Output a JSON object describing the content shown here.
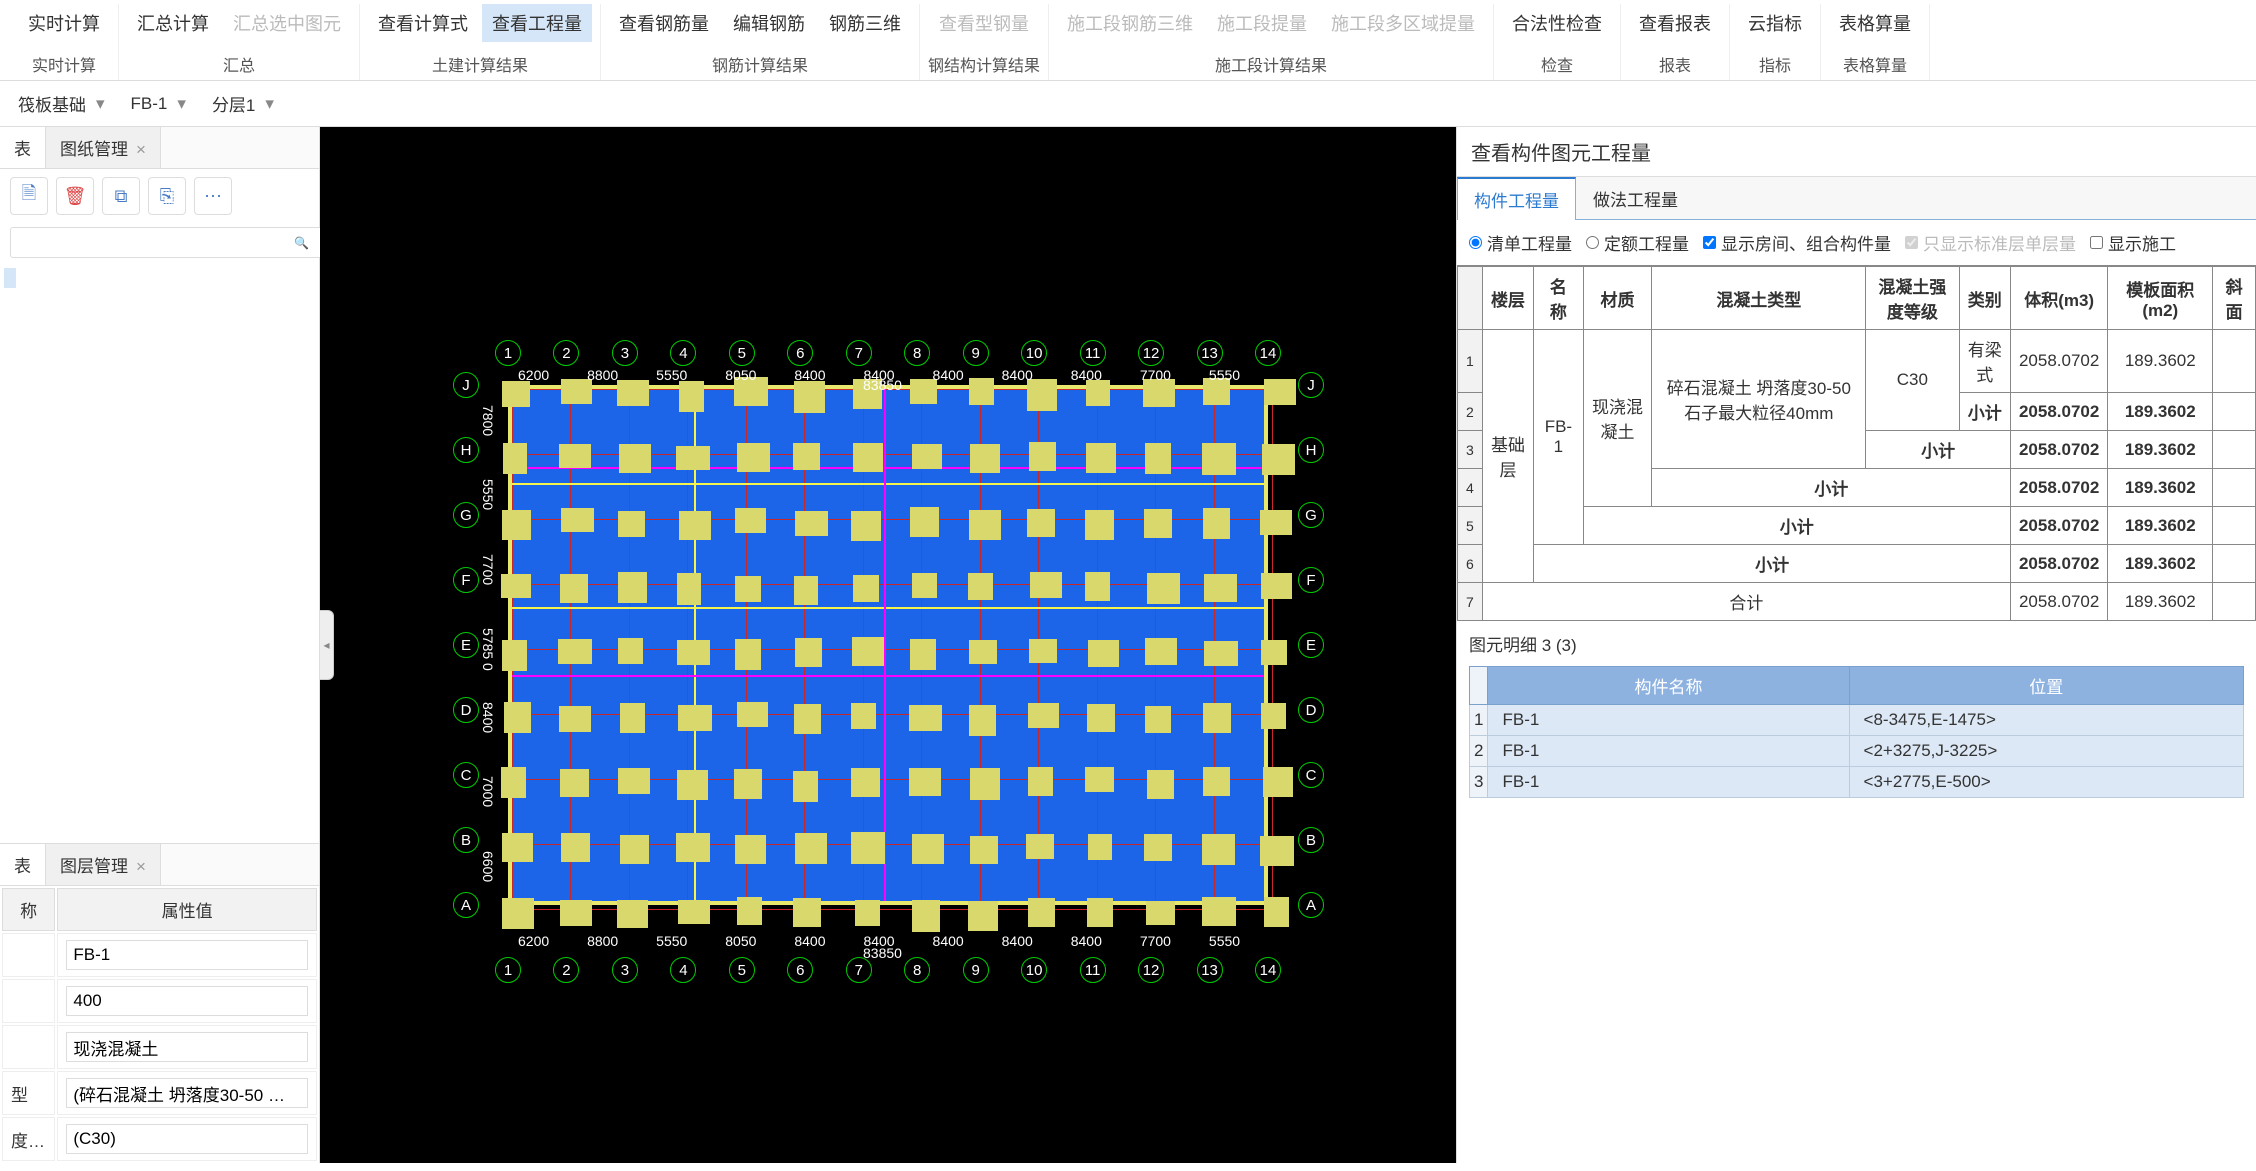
{
  "ribbon": {
    "groups": [
      {
        "label": "实时计算",
        "buttons": [
          {
            "t": "实时计算"
          }
        ]
      },
      {
        "label": "汇总",
        "buttons": [
          {
            "t": "汇总计算"
          },
          {
            "t": "汇总选中图元",
            "disabled": true
          }
        ]
      },
      {
        "label": "土建计算结果",
        "buttons": [
          {
            "t": "查看计算式"
          },
          {
            "t": "查看工程量",
            "active": true
          }
        ]
      },
      {
        "label": "钢筋计算结果",
        "buttons": [
          {
            "t": "查看钢筋量"
          },
          {
            "t": "编辑钢筋"
          },
          {
            "t": "钢筋三维"
          }
        ]
      },
      {
        "label": "钢结构计算结果",
        "buttons": [
          {
            "t": "查看型钢量",
            "disabled": true
          }
        ]
      },
      {
        "label": "施工段计算结果",
        "buttons": [
          {
            "t": "施工段钢筋三维",
            "disabled": true
          },
          {
            "t": "施工段提量",
            "disabled": true
          },
          {
            "t": "施工段多区域提量",
            "disabled": true
          }
        ]
      },
      {
        "label": "检查",
        "buttons": [
          {
            "t": "合法性检查"
          }
        ]
      },
      {
        "label": "报表",
        "buttons": [
          {
            "t": "查看报表"
          }
        ]
      },
      {
        "label": "指标",
        "buttons": [
          {
            "t": "云指标"
          }
        ]
      },
      {
        "label": "表格算量",
        "buttons": [
          {
            "t": "表格算量"
          }
        ]
      }
    ]
  },
  "selectors": {
    "a": "筏板基础",
    "b": "FB-1",
    "c": "分层1"
  },
  "leftTabs": {
    "tab1": "表",
    "tab2": "图纸管理"
  },
  "chip": "",
  "propPanel": {
    "tab1": "表",
    "tab2": "图层管理",
    "colName": "称",
    "colVal": "属性值",
    "rows": [
      {
        "k": "",
        "v": "FB-1"
      },
      {
        "k": "",
        "v": "400"
      },
      {
        "k": "",
        "v": "现浇混凝土"
      },
      {
        "k": "型",
        "v": "(碎石混凝土 坍落度30-50 …"
      },
      {
        "k": "度…",
        "v": "(C30)"
      }
    ]
  },
  "rightPanel": {
    "title": "查看构件图元工程量",
    "tabA": "构件工程量",
    "tabB": "做法工程量",
    "filters": {
      "radio1": "清单工程量",
      "radio2": "定额工程量",
      "chk1": "显示房间、组合构件量",
      "chk2": "只显示标准层单层量",
      "chk3": "显示施工"
    },
    "headers": [
      "楼层",
      "名称",
      "材质",
      "混凝土类型",
      "混凝土强度等级",
      "类别",
      "体积(m3)",
      "模板面积(m2)",
      "斜面"
    ],
    "rows": [
      {
        "n": "1",
        "floor": "基础层",
        "name": "FB-1",
        "mat": "现浇混凝土",
        "ctype": "碎石混凝土 坍落度30-50 石子最大粒径40mm",
        "grade": "C30",
        "cat": "有梁式",
        "vol": "2058.0702",
        "area": "189.3602"
      },
      {
        "n": "2",
        "cat": "小计",
        "vol": "2058.0702",
        "area": "189.3602",
        "bold": true
      },
      {
        "n": "3",
        "span": "grade_cat",
        "label": "小计",
        "vol": "2058.0702",
        "area": "189.3602",
        "bold": true
      },
      {
        "n": "4",
        "span": "ctype_cat",
        "label": "小计",
        "vol": "2058.0702",
        "area": "189.3602",
        "bold": true
      },
      {
        "n": "5",
        "span": "mat_cat",
        "label": "小计",
        "vol": "2058.0702",
        "area": "189.3602",
        "bold": true
      },
      {
        "n": "6",
        "span": "name_cat",
        "label": "小计",
        "vol": "2058.0702",
        "area": "189.3602",
        "bold": true
      },
      {
        "n": "7",
        "span": "all",
        "label": "合计",
        "vol": "2058.0702",
        "area": "189.3602"
      }
    ],
    "detailTitle": "图元明细  3 (3)",
    "detailHeaders": [
      "构件名称",
      "位置"
    ],
    "detailRows": [
      {
        "n": "1",
        "name": "FB-1",
        "pos": "<8-3475,E-1475>"
      },
      {
        "n": "2",
        "name": "FB-1",
        "pos": "<2+3275,J-3225>"
      },
      {
        "n": "3",
        "name": "FB-1",
        "pos": "<3+2775,E-500>"
      }
    ]
  },
  "plan": {
    "colLabels": [
      "1",
      "2",
      "3",
      "4",
      "5",
      "6",
      "7",
      "8",
      "9",
      "10",
      "11",
      "12",
      "13",
      "14"
    ],
    "rowLabels": [
      "J",
      "H",
      "G",
      "F",
      "E",
      "D",
      "C",
      "B",
      "A"
    ],
    "dimsTop": [
      "6200",
      "8800",
      "5550",
      "8050",
      "8400",
      "8400",
      "8400",
      "8400",
      "8400",
      "7700",
      "5550"
    ],
    "centerDim": "83850",
    "dimsLeft": [
      "7800",
      "5550",
      "7700",
      "5785 0",
      "8400",
      "7000",
      "6600"
    ]
  }
}
